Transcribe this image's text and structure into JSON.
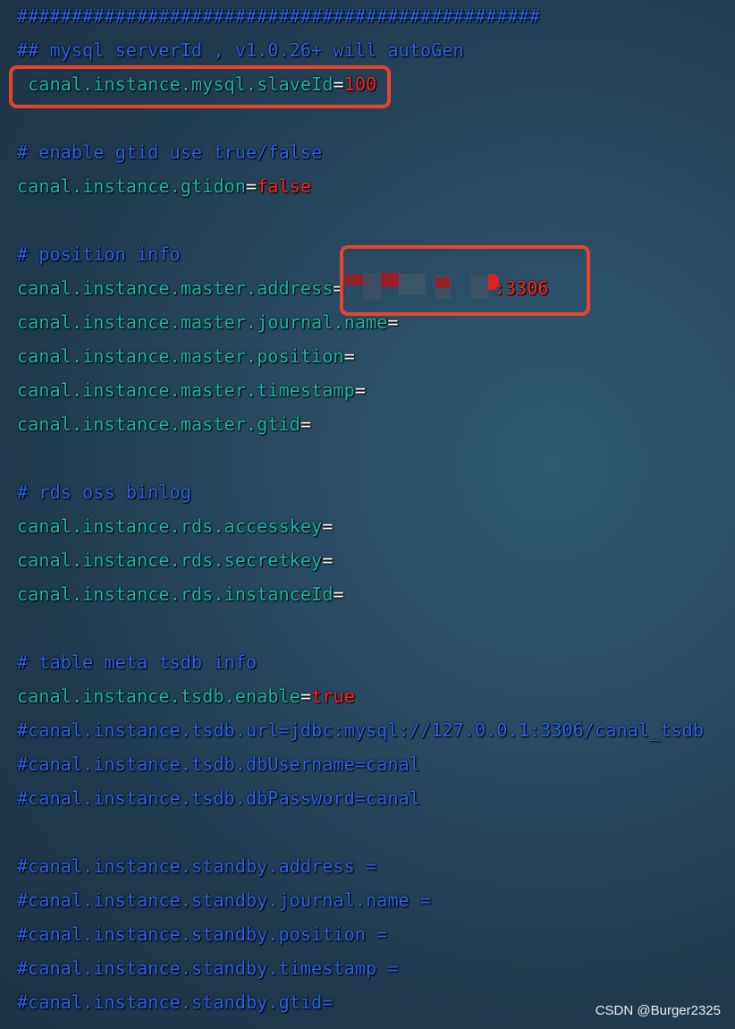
{
  "colors": {
    "comment": "#2a63e6",
    "key": "#1eb3a8",
    "equals": "#ffffff",
    "value": "#ff2222",
    "highlight_box": "#e8432b"
  },
  "lines": [
    {
      "comment": "################################################"
    },
    {
      "comment": "## mysql serverId , v1.0.26+ will autoGen"
    },
    {
      "key": " canal.instance.mysql.slaveId",
      "eq": "=",
      "value": "100"
    },
    {},
    {
      "comment": "# enable gtid use true/false"
    },
    {
      "key": "canal.instance.gtidon",
      "eq": "=",
      "value": "false"
    },
    {},
    {
      "comment": "# position info"
    },
    {
      "key": "canal.instance.master.address",
      "eq": "=",
      "value": ":3306",
      "redacted": true
    },
    {
      "key": "canal.instance.master.journal.name",
      "eq": "="
    },
    {
      "key": "canal.instance.master.position",
      "eq": "="
    },
    {
      "key": "canal.instance.master.timestamp",
      "eq": "="
    },
    {
      "key": "canal.instance.master.gtid",
      "eq": "="
    },
    {},
    {
      "comment": "# rds oss binlog"
    },
    {
      "key": "canal.instance.rds.accesskey",
      "eq": "="
    },
    {
      "key": "canal.instance.rds.secretkey",
      "eq": "="
    },
    {
      "key": "canal.instance.rds.instanceId",
      "eq": "="
    },
    {},
    {
      "comment": "# table meta tsdb info"
    },
    {
      "key": "canal.instance.tsdb.enable",
      "eq": "=",
      "value": "true"
    },
    {
      "comment": "#canal.instance.tsdb.url=jdbc:mysql://127.0.0.1:3306/canal_tsdb"
    },
    {
      "comment": "#canal.instance.tsdb.dbUsername=canal"
    },
    {
      "comment": "#canal.instance.tsdb.dbPassword=canal"
    },
    {},
    {
      "comment": "#canal.instance.standby.address ="
    },
    {
      "comment": "#canal.instance.standby.journal.name ="
    },
    {
      "comment": "#canal.instance.standby.position ="
    },
    {
      "comment": "#canal.instance.standby.timestamp ="
    },
    {
      "comment": "#canal.instance.standby.gtid="
    }
  ],
  "watermark": "CSDN @Burger2325"
}
